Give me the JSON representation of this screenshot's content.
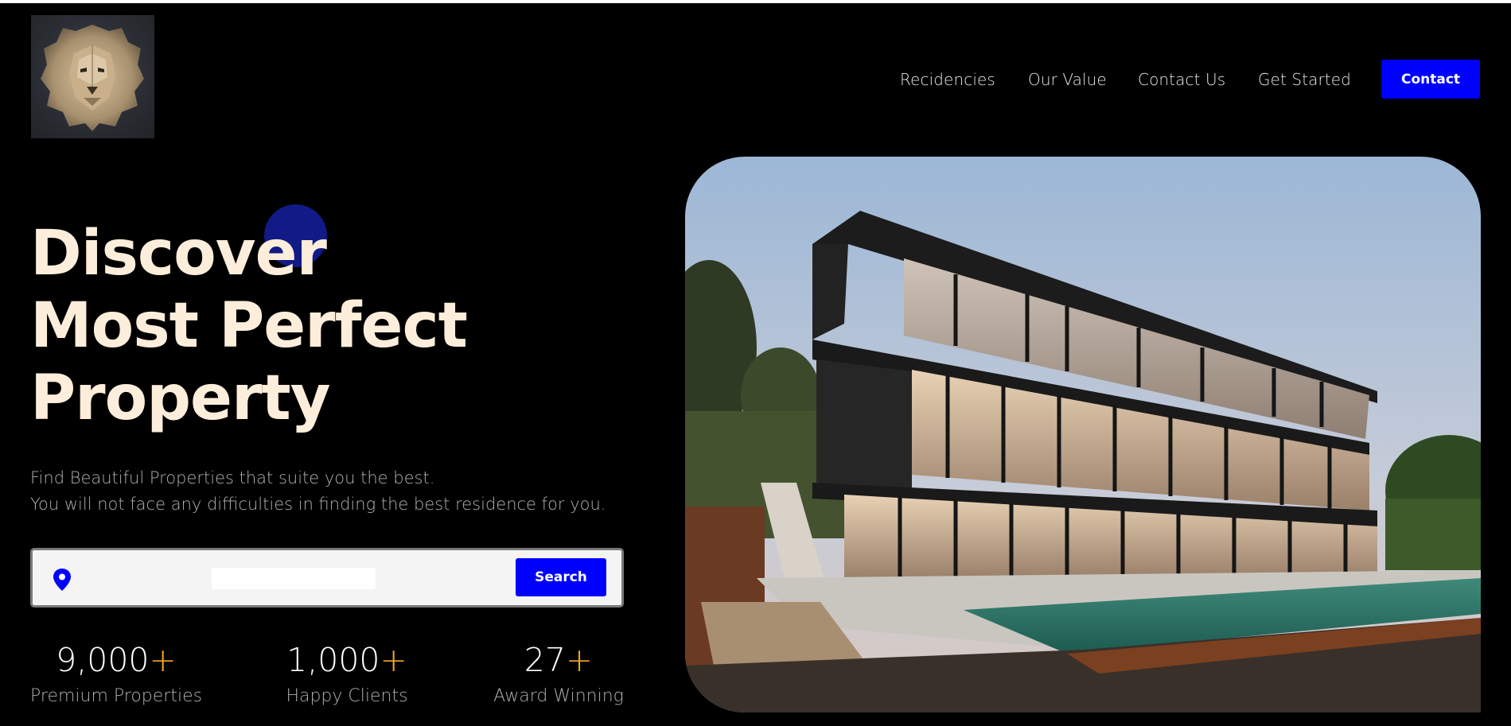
{
  "brand": {
    "logo_icon": "lion-head-icon"
  },
  "nav": {
    "links": [
      "Recidencies",
      "Our Value",
      "Contact Us",
      "Get Started"
    ],
    "contact_label": "Contact"
  },
  "hero": {
    "title_lines": [
      "Discover",
      "Most Perfect",
      "Property"
    ],
    "subtitle_lines": [
      "Find Beautiful Properties that suite you the best.",
      "You will not face any difficulties in finding the best residence for you."
    ]
  },
  "search": {
    "icon": "location-pin-icon",
    "value": "",
    "button_label": "Search"
  },
  "stats": [
    {
      "number": "9,000",
      "plus": "+",
      "label": "Premium Properties"
    },
    {
      "number": "1,000",
      "plus": "+",
      "label": "Happy Clients"
    },
    {
      "number": "27",
      "plus": "+",
      "label": "Award Winning"
    }
  ],
  "colors": {
    "accent": "#0000ff",
    "plus": "#f5a623",
    "title": "#fdeedb",
    "blob": "#111a86"
  }
}
